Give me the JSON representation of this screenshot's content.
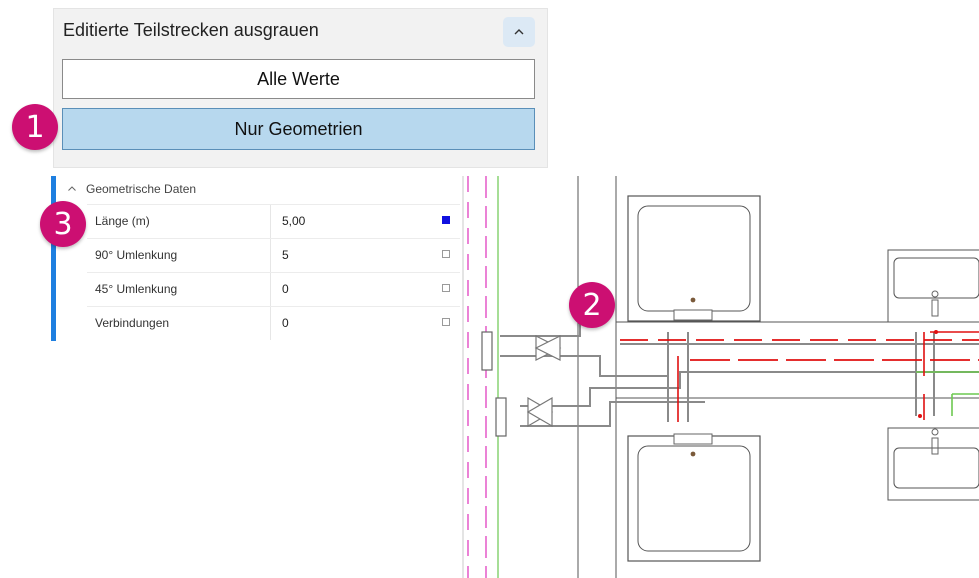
{
  "panel": {
    "header": "Editierte Teilstrecken ausgrauen",
    "collapse_icon": "chevron-up-icon",
    "btn_all": "Alle Werte",
    "btn_geometry": "Nur Geometrien",
    "selected": "Nur Geometrien"
  },
  "property_grid": {
    "category": "Geometrische Daten",
    "rows": [
      {
        "name": "Länge (m)",
        "value": "5,00",
        "checked": true
      },
      {
        "name": "90° Umlenkung",
        "value": "5",
        "checked": false
      },
      {
        "name": "45° Umlenkung",
        "value": "0",
        "checked": false
      },
      {
        "name": "Verbindungen",
        "value": "0",
        "checked": false
      }
    ]
  },
  "callouts": [
    "1",
    "2",
    "3"
  ],
  "colors": {
    "badge": "#cc0f72",
    "selected_button": "#b7d8ee",
    "accent_bar": "#1e7fe0",
    "pipe_red": "#e01010",
    "pipe_green": "#5cc040",
    "pipe_magenta": "#e040c0",
    "pipe_gray": "#8a8a8a"
  }
}
